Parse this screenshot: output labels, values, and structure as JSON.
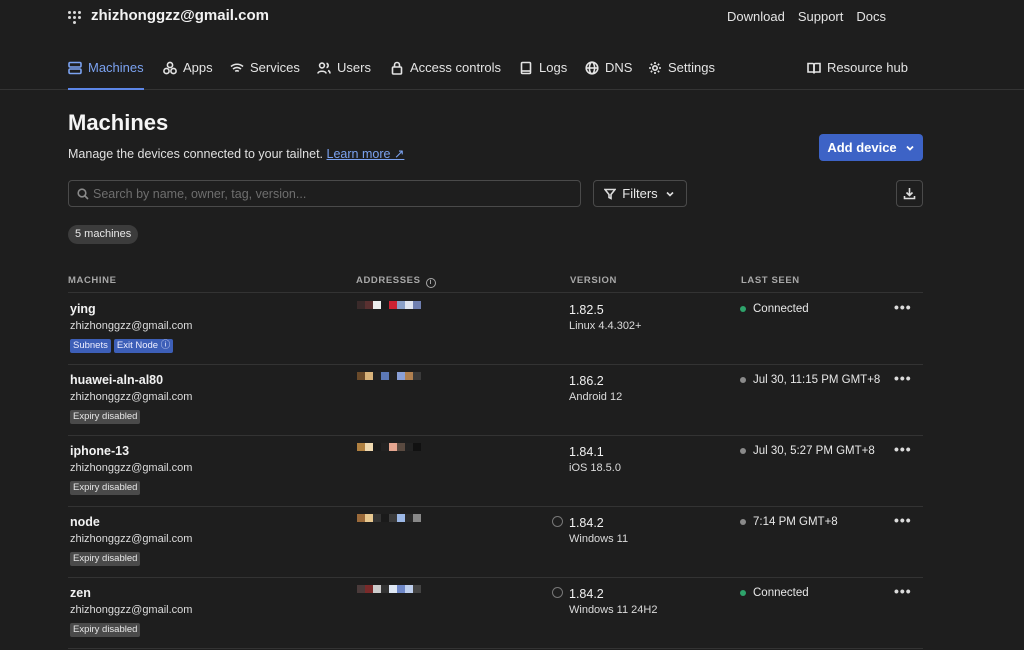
{
  "header": {
    "account": "zhizhonggzz@gmail.com",
    "links": [
      "Download",
      "Support",
      "Docs"
    ]
  },
  "nav": {
    "tabs": [
      {
        "label": "Machines",
        "icon": "machines-icon",
        "active": true
      },
      {
        "label": "Apps",
        "icon": "apps-icon"
      },
      {
        "label": "Services",
        "icon": "wifi-icon"
      },
      {
        "label": "Users",
        "icon": "users-icon"
      },
      {
        "label": "Access controls",
        "icon": "lock-icon"
      },
      {
        "label": "Logs",
        "icon": "book-icon"
      },
      {
        "label": "DNS",
        "icon": "globe-icon"
      },
      {
        "label": "Settings",
        "icon": "gear-icon"
      }
    ],
    "resource_hub": "Resource hub"
  },
  "page": {
    "title": "Machines",
    "subtitle": "Manage the devices connected to your tailnet.",
    "learn_more": "Learn more ↗",
    "add_device": "Add device",
    "search_placeholder": "Search by name, owner, tag, version...",
    "filters": "Filters",
    "count": "5 machines"
  },
  "table": {
    "headers": [
      "MACHINE",
      "ADDRESSES",
      "VERSION",
      "LAST SEEN"
    ],
    "rows": [
      {
        "name": "ying",
        "owner": "zhizhonggzz@gmail.com",
        "tags": [
          "Subnets",
          "Exit Node ⓘ"
        ],
        "tag_style": "blue",
        "version": "1.82.5",
        "os": "Linux 4.4.302+",
        "update": false,
        "last_seen": "Connected",
        "status": "online"
      },
      {
        "name": "huawei-aln-al80",
        "owner": "zhizhonggzz@gmail.com",
        "tags": [
          "Expiry disabled"
        ],
        "tag_style": "gray",
        "version": "1.86.2",
        "os": "Android 12",
        "update": false,
        "last_seen": "Jul 30, 11:15 PM GMT+8",
        "status": "offline"
      },
      {
        "name": "iphone-13",
        "owner": "zhizhonggzz@gmail.com",
        "tags": [
          "Expiry disabled"
        ],
        "tag_style": "gray",
        "version": "1.84.1",
        "os": "iOS 18.5.0",
        "update": false,
        "last_seen": "Jul 30, 5:27 PM GMT+8",
        "status": "offline"
      },
      {
        "name": "node",
        "owner": "zhizhonggzz@gmail.com",
        "tags": [
          "Expiry disabled"
        ],
        "tag_style": "gray",
        "version": "1.84.2",
        "os": "Windows 11",
        "update": true,
        "last_seen": "7:14 PM GMT+8",
        "status": "offline"
      },
      {
        "name": "zen",
        "owner": "zhizhonggzz@gmail.com",
        "tags": [
          "Expiry disabled"
        ],
        "tag_style": "gray",
        "version": "1.84.2",
        "os": "Windows 11 24H2",
        "update": true,
        "last_seen": "Connected",
        "status": "online"
      }
    ]
  },
  "colors": {
    "accent": "#3d63c6",
    "online": "#2ea36b",
    "offline": "#8a8a8a"
  }
}
